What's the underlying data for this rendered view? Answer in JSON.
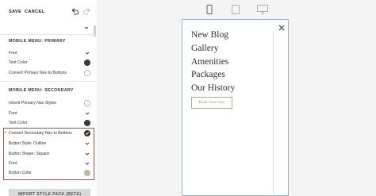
{
  "toolbar": {
    "save": "SAVE",
    "cancel": "CANCEL"
  },
  "primary": {
    "title": "MOBILE MENU: PRIMARY",
    "rows": [
      "Font",
      "Text Color",
      "Convert Primary Nav to Buttons"
    ]
  },
  "secondary": {
    "title": "MOBILE MENU: SECONDARY",
    "rows": [
      "Inherit Primary Nav Styles",
      "Font",
      "Text Color",
      "Convert Secondary Nav to Buttons",
      "Button Style: Outline",
      "Button Shape: Square",
      "Font",
      "Button Color"
    ]
  },
  "import_button": "IMPORT STYLE PACK (BETA)",
  "preview": {
    "nav": [
      "New Blog",
      "Gallery",
      "Amenities",
      "Packages",
      "Our History"
    ],
    "book_button": "Book Your Stay"
  },
  "colors": {
    "dark_swatch": "#3a3a3a",
    "button_color": "#b7bb9e",
    "highlight": "#9c5a44",
    "accent_outline": "#a7ae96"
  }
}
